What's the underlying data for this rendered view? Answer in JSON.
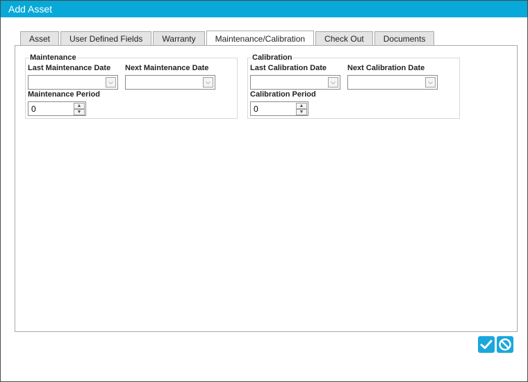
{
  "window": {
    "title": "Add Asset"
  },
  "tabs": [
    {
      "label": "Asset",
      "active": false
    },
    {
      "label": "User Defined Fields",
      "active": false
    },
    {
      "label": "Warranty",
      "active": false
    },
    {
      "label": "Maintenance/Calibration",
      "active": true
    },
    {
      "label": "Check Out",
      "active": false
    },
    {
      "label": "Documents",
      "active": false
    }
  ],
  "maintenance": {
    "legend": "Maintenance",
    "last_date_label": "Last Maintenance Date",
    "last_date_value": "",
    "next_date_label": "Next Maintenance Date",
    "next_date_value": "",
    "period_label": "Maintenance Period",
    "period_value": "0"
  },
  "calibration": {
    "legend": "Calibration",
    "last_date_label": "Last Calibration Date",
    "last_date_value": "",
    "next_date_label": "Next Calibration Date",
    "next_date_value": "",
    "period_label": "Calibration Period",
    "period_value": "0"
  },
  "actions": {
    "ok_icon": "checkmark-icon",
    "cancel_icon": "cancel-icon"
  },
  "colors": {
    "accent": "#08a9d8",
    "button": "#1aa7dc"
  }
}
